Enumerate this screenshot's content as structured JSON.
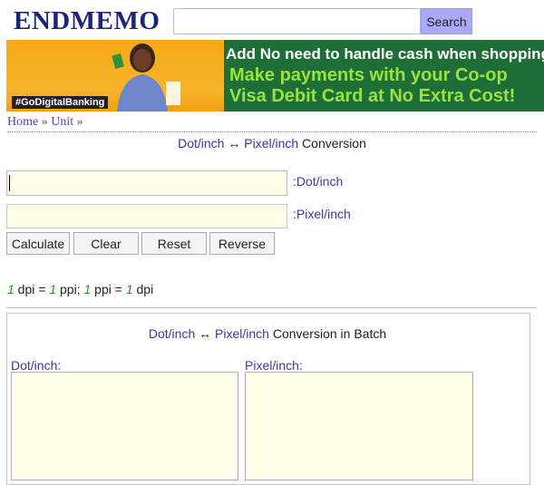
{
  "header": {
    "logo": "ENDMEMO",
    "search_button": "Search"
  },
  "banner": {
    "line1": "Add No need to handle cash when shopping",
    "line2": "Make payments with your Co-op",
    "line3": "Visa Debit Card at No Extra Cost!",
    "hashtag": "#GoDigitalBanking"
  },
  "breadcrumb": {
    "home": "Home",
    "sep": " » ",
    "unit": "Unit",
    "trail": " »"
  },
  "converter": {
    "title_from": "Dot/inch",
    "arrow": " ↔ ",
    "title_to": "Pixel/inch",
    "title_suffix": " Conversion",
    "field1_unit": ":Dot/inch",
    "field2_unit": ":Pixel/inch",
    "buttons": {
      "calculate": "Calculate",
      "clear": "Clear",
      "reset": "Reset",
      "reverse": "Reverse"
    }
  },
  "formula": {
    "a": "1",
    "b": " dpi = ",
    "c": "1",
    "d": " ppi; ",
    "e": "1",
    "f": " ppi = ",
    "g": "1",
    "h": " dpi"
  },
  "batch": {
    "title_from": "Dot/inch",
    "arrow": " ↔ ",
    "title_to": "Pixel/inch",
    "title_suffix": " Conversion in Batch",
    "label_from": "Dot/inch:",
    "label_to": "Pixel/inch:"
  }
}
